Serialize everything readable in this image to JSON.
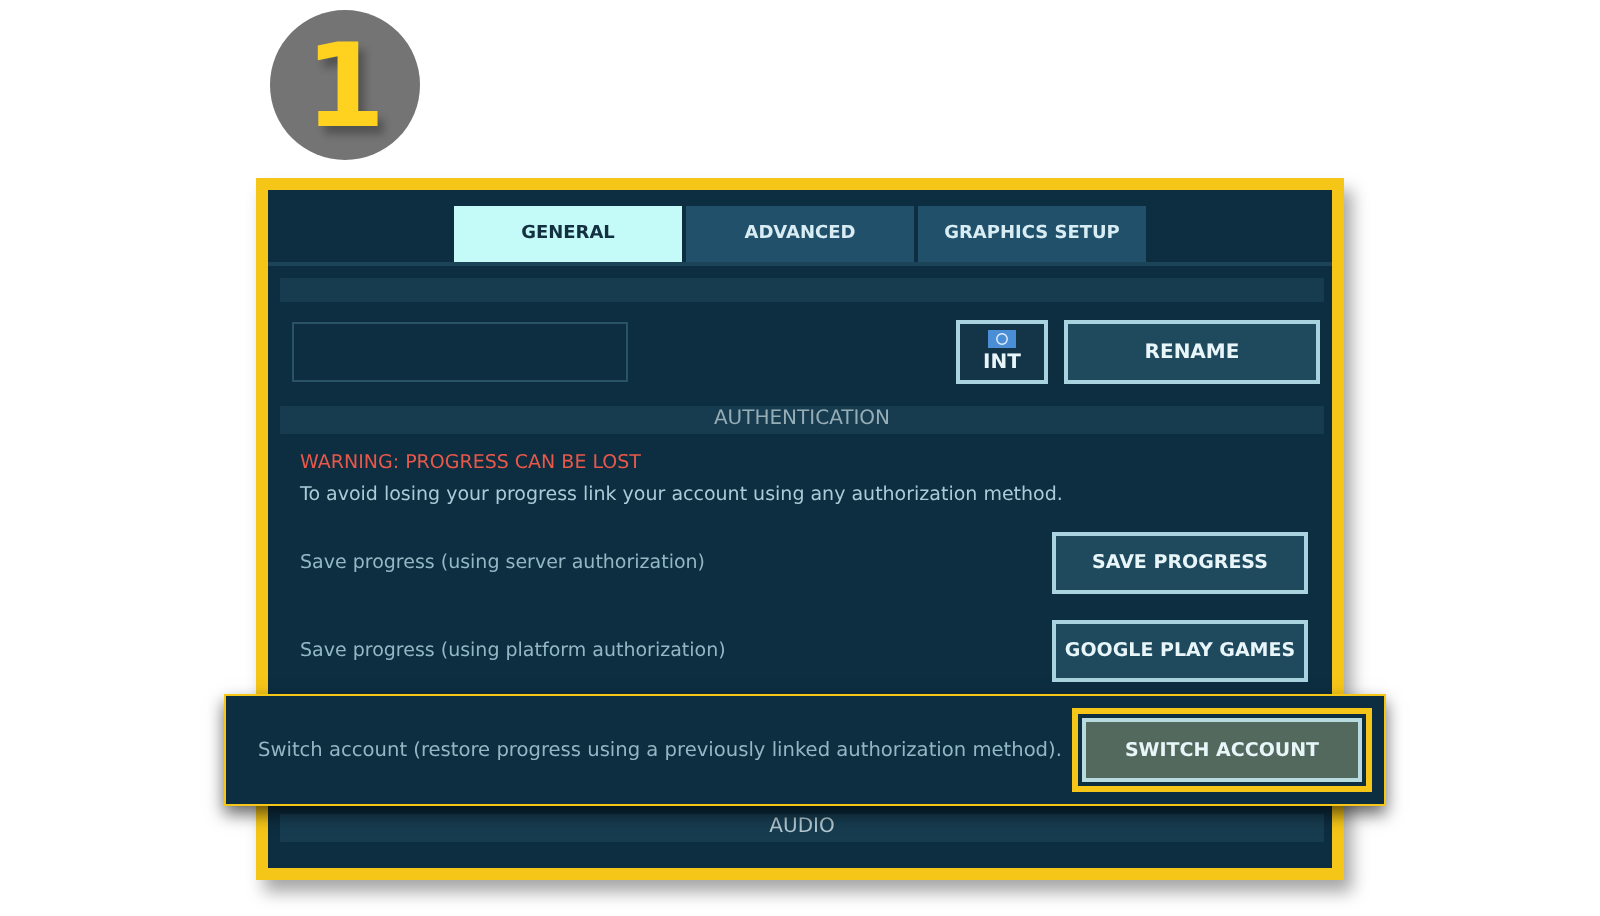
{
  "step_badge": "1",
  "tabs": [
    {
      "label": "GENERAL",
      "selected": true
    },
    {
      "label": "ADVANCED",
      "selected": false
    },
    {
      "label": "GRAPHICS SETUP",
      "selected": false
    }
  ],
  "profile": {
    "region_button": "INT",
    "rename_button": "RENAME"
  },
  "authentication": {
    "title": "AUTHENTICATION",
    "warning": "WARNING: PROGRESS CAN BE LOST",
    "description": "To avoid losing your progress link your account using any authorization method.",
    "rows": [
      {
        "label": "Save progress (using server authorization)",
        "button": "SAVE PROGRESS",
        "highlighted": false
      },
      {
        "label": "Save progress (using platform authorization)",
        "button": "GOOGLE PLAY GAMES",
        "highlighted": false
      },
      {
        "label": "Switch account (restore progress using a previously linked authorization method).",
        "button": "SWITCH ACCOUNT",
        "highlighted": true
      }
    ]
  },
  "audio": {
    "title": "AUDIO"
  }
}
